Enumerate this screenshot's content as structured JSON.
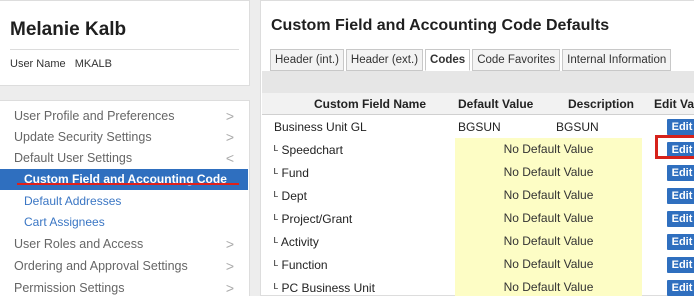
{
  "user": {
    "name": "Melanie Kalb",
    "username_label": "User Name",
    "username": "MKALB"
  },
  "menu": {
    "items": [
      {
        "label": "User Profile and Preferences",
        "chevron": ">"
      },
      {
        "label": "Update Security Settings",
        "chevron": ">"
      },
      {
        "label": "Default User Settings",
        "chevron": "<"
      },
      {
        "label": "User Roles and Access",
        "chevron": ">"
      },
      {
        "label": "Ordering and Approval Settings",
        "chevron": ">"
      },
      {
        "label": "Permission Settings",
        "chevron": ">"
      }
    ],
    "subitems": [
      {
        "label": "Custom Field and Accounting Code Defaults",
        "active": true
      },
      {
        "label": "Default Addresses",
        "active": false
      },
      {
        "label": "Cart Assignees",
        "active": false
      }
    ]
  },
  "panel": {
    "title": "Custom Field and Accounting Code Defaults",
    "tabs": [
      "Header (int.)",
      "Header (ext.)",
      "Codes",
      "Code Favorites",
      "Internal Information"
    ],
    "active_tab": "Codes"
  },
  "table": {
    "headers": [
      "Custom Field Name",
      "Default Value",
      "Description",
      "Edit Valu"
    ],
    "rows": [
      {
        "name": "Business Unit GL",
        "default": "BGSUN",
        "description": "BGSUN",
        "edit": "Edit"
      },
      {
        "name": "ᴸ Speedchart",
        "no_default": "No Default Value",
        "edit": "Edit"
      },
      {
        "name": "ᴸ Fund",
        "no_default": "No Default Value",
        "edit": "Edit"
      },
      {
        "name": "ᴸ Dept",
        "no_default": "No Default Value",
        "edit": "Edit"
      },
      {
        "name": "ᴸ Project/Grant",
        "no_default": "No Default Value",
        "edit": "Edit"
      },
      {
        "name": "ᴸ Activity",
        "no_default": "No Default Value",
        "edit": "Edit"
      },
      {
        "name": "ᴸ Function",
        "no_default": "No Default Value",
        "edit": "Edit"
      },
      {
        "name": "ᴸ PC Business Unit",
        "no_default": "No Default Value",
        "edit": "Edit"
      }
    ]
  },
  "colors": {
    "accent": "#2f6fbf",
    "highlight_red": "#d6221b",
    "no_default_bg": "#fdfdc5"
  }
}
